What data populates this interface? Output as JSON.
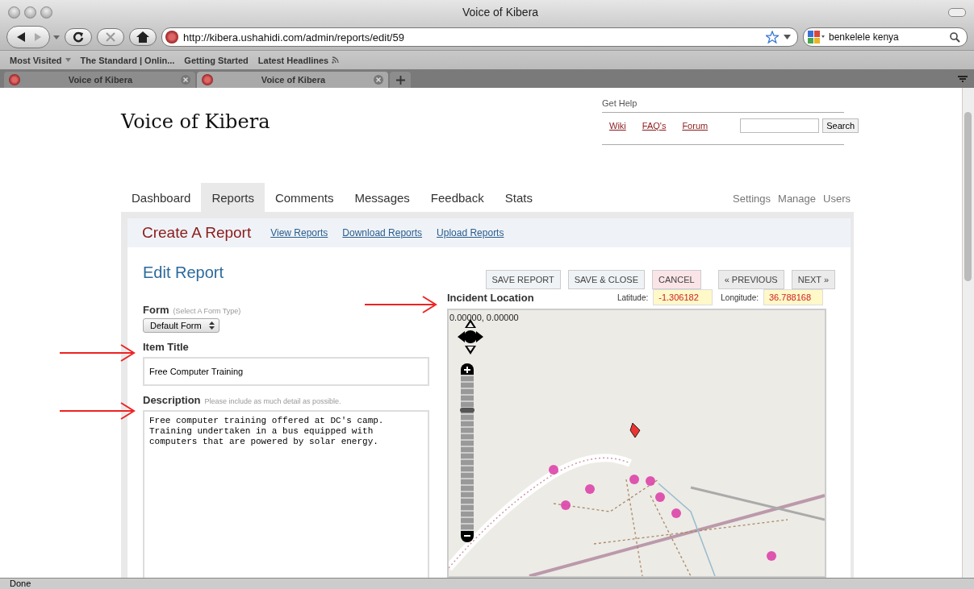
{
  "window": {
    "title": "Voice of Kibera"
  },
  "toolbar": {
    "url": "http://kibera.ushahidi.com/admin/reports/edit/59",
    "search": "benkelele kenya"
  },
  "bookmarks": [
    {
      "label": "Most Visited",
      "kind": "menu"
    },
    {
      "label": "The Standard | Onlin...",
      "kind": "link"
    },
    {
      "label": "Getting Started",
      "kind": "link"
    },
    {
      "label": "Latest Headlines",
      "kind": "feed"
    }
  ],
  "tabs": [
    {
      "label": "Voice of Kibera",
      "selected": false
    },
    {
      "label": "Voice of Kibera",
      "selected": true
    }
  ],
  "page": {
    "site_title": "Voice of Kibera",
    "help": {
      "heading": "Get Help",
      "links": [
        "Wiki",
        "FAQ's",
        "Forum"
      ],
      "search_button": "Search"
    },
    "nav": [
      {
        "label": "Dashboard",
        "selected": false
      },
      {
        "label": "Reports",
        "selected": true
      },
      {
        "label": "Comments",
        "selected": false
      },
      {
        "label": "Messages",
        "selected": false
      },
      {
        "label": "Feedback",
        "selected": false
      },
      {
        "label": "Stats",
        "selected": false
      }
    ],
    "admin_links": [
      "Settings",
      "Manage",
      "Users"
    ],
    "subnav": {
      "title": "Create A Report",
      "links": [
        "View Reports",
        "Download Reports",
        "Upload Reports"
      ]
    },
    "heading": "Edit Report",
    "buttons": [
      {
        "label": "SAVE REPORT",
        "kind": "save"
      },
      {
        "label": "SAVE & CLOSE",
        "kind": "save"
      },
      {
        "label": "CANCEL",
        "kind": "cancel"
      },
      {
        "label": "« PREVIOUS",
        "kind": "nav"
      },
      {
        "label": "NEXT »",
        "kind": "nav"
      }
    ],
    "form": {
      "label": "Form",
      "hint": "(Select A Form Type)",
      "value": "Default Form"
    },
    "item_title": {
      "label": "Item Title",
      "value": "Free Computer Training"
    },
    "description": {
      "label": "Description",
      "hint": "Please include as much detail as possible.",
      "value": "Free computer training offered at DC's camp.\nTraining undertaken in a bus equipped with\ncomputers that are powered by solar energy."
    },
    "location": {
      "label": "Incident Location",
      "latitude_label": "Latitude:",
      "latitude": "-1.306182",
      "longitude_label": "Longitude:",
      "longitude": "36.788168",
      "coords": "0.00000, 0.00000",
      "zoom": {
        "level": 0.78
      }
    }
  },
  "status_bar": "Done"
}
